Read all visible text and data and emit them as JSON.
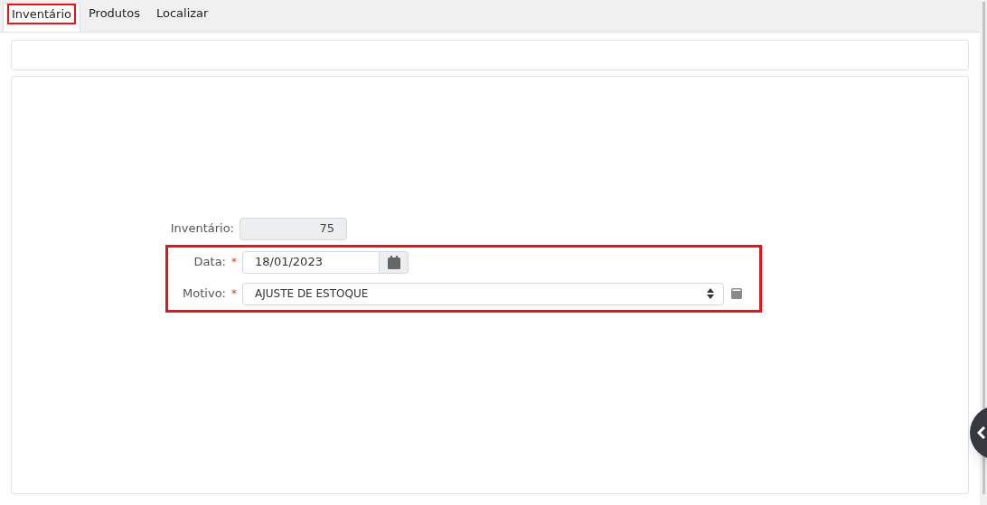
{
  "tabs": [
    {
      "label": "Inventário",
      "selected": true,
      "highlighted": true
    },
    {
      "label": "Produtos",
      "selected": false,
      "highlighted": false
    },
    {
      "label": "Localizar",
      "selected": false,
      "highlighted": false
    }
  ],
  "form": {
    "inventory": {
      "label": "Inventário:",
      "value": "75",
      "disabled": true
    },
    "highlighted": true,
    "date": {
      "label": "Data:",
      "required": true,
      "required_mark": "*",
      "value": "18/01/2023"
    },
    "reason": {
      "label": "Motivo:",
      "required": true,
      "required_mark": "*",
      "value": "AJUSTE DE ESTOQUE"
    }
  }
}
